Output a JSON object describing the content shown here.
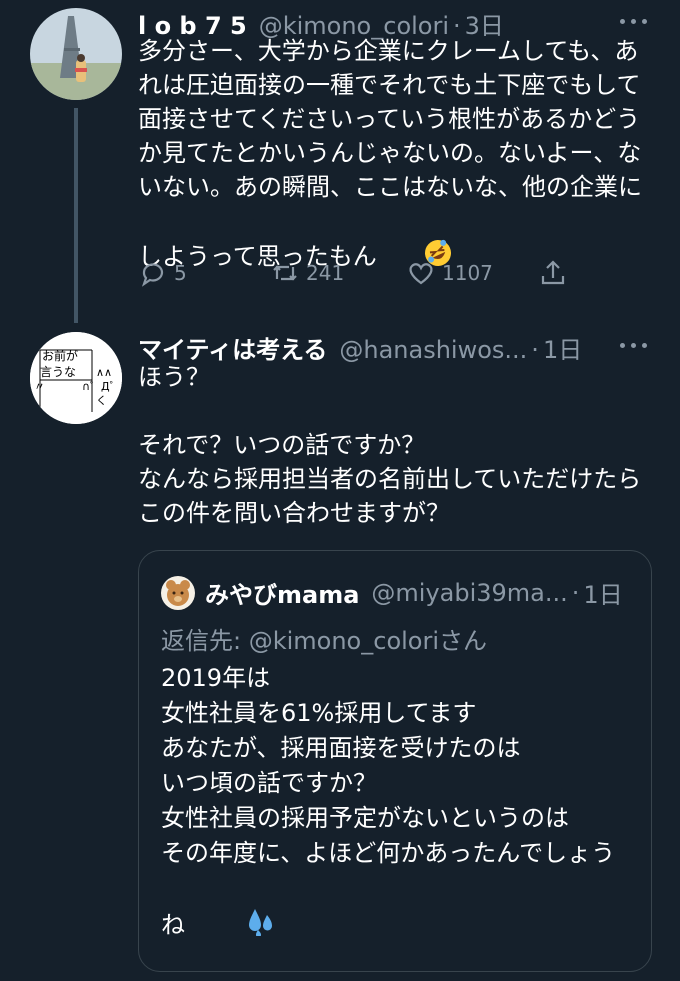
{
  "tweet1": {
    "display_name": "l o b 7 5",
    "handle": "@kimono_colori",
    "separator": "·",
    "time": "3日",
    "text": "多分さー、大学から企業にクレームしても、あれは圧迫面接の一種でそれでも土下座でもして面接させてくださいっていう根性があるかどうか見てたとかいうんじゃないの。ないよー、ないない。あの瞬間、ここはないな、他の企業にしようって思ったもん",
    "emoji": "rolling-on-floor-laughing-emoji",
    "replies": "5",
    "retweets": "241",
    "likes": "1107"
  },
  "tweet2": {
    "display_name": "マイティは考える",
    "handle": "@hanashiwos...",
    "separator": "·",
    "time": "1日",
    "avatar_text": [
      "お前が",
      "言うな",
      "∧∧",
      "∩゜Д゜)",
      "〃",
      "く"
    ],
    "text": "ほう？\n\nそれで？いつの話ですか？\nなんなら採用担当者の名前出していただけたらこの件を問い合わせますが？",
    "quote": {
      "display_name": "みやびmama",
      "handle": "@miyabi39ma...",
      "separator": "·",
      "time": "1日",
      "reply_prefix": "返信先: ",
      "reply_mention": "@kimono_colori",
      "reply_suffix": "さん",
      "text": "2019年は\n女性社員を61%採用してます\nあなたが、採用面接を受けたのは\nいつ頃の話ですか？\n女性社員の採用予定がないというのは\nその年度に、よほど何かあったんでしょうね",
      "emoji": "sweat-droplets-emoji"
    }
  },
  "colors": {
    "background": "#15202b",
    "text": "#ffffff",
    "secondary": "#8b98a5",
    "thread_line": "#425565",
    "quote_border": "#38444d"
  }
}
